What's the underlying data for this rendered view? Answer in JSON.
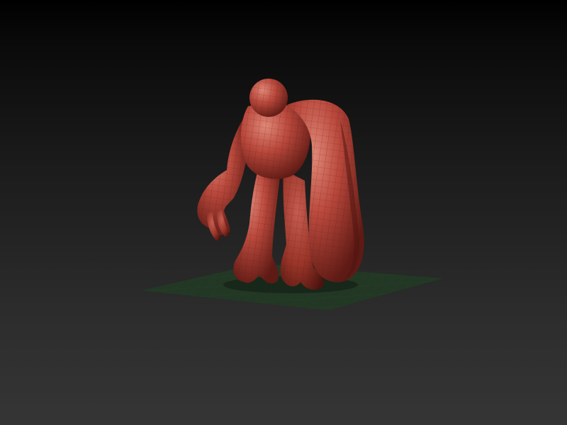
{
  "viewport": {
    "background_top": "#000000",
    "background_bottom": "#353535",
    "model_color": "#b9483c",
    "model_shadow_color": "#5e1a14",
    "model_highlight_color": "#e28a7a",
    "wire_color": "#6a1f18",
    "floor_grid_color": "#243a25"
  },
  "model": {
    "name_icon": "sculpted-creature-mesh"
  }
}
